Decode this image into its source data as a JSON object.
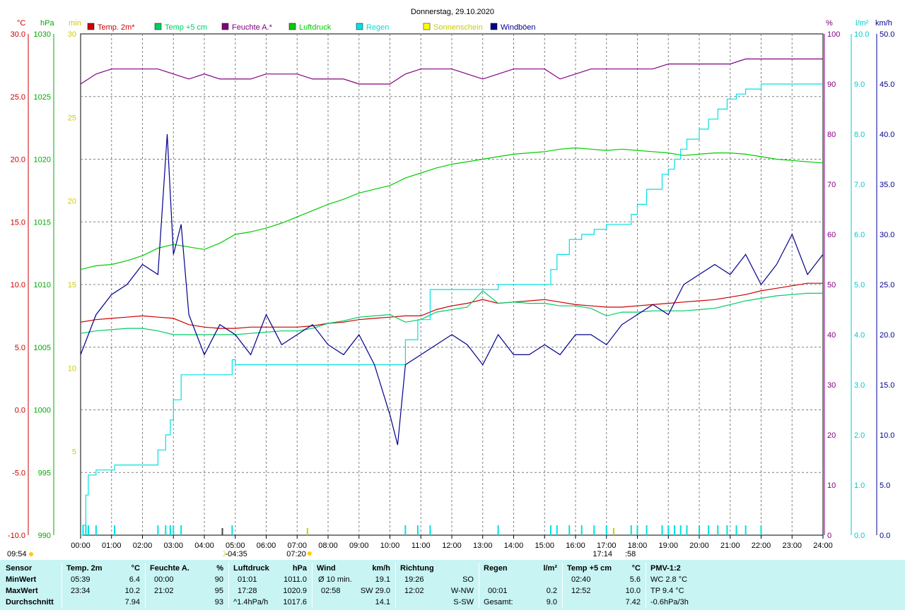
{
  "chart_data": {
    "type": "line",
    "title": "Donnerstag, 29.10.2020",
    "x_ticks": [
      "00:00",
      "01:00",
      "02:00",
      "03:00",
      "04:00",
      "05:00",
      "06:00",
      "07:00",
      "08:00",
      "09:00",
      "10:00",
      "11:00",
      "12:00",
      "13:00",
      "14:00",
      "15:00",
      "16:00",
      "17:00",
      "18:00",
      "19:00",
      "20:00",
      "21:00",
      "22:00",
      "23:00",
      "24:00"
    ],
    "xlim_hours": [
      0,
      24
    ],
    "axes": {
      "temp_c": {
        "unit": "°C",
        "range": [
          -10,
          30
        ],
        "ticks": [
          "-10.0",
          "-5.0",
          "0.0",
          "5.0",
          "10.0",
          "15.0",
          "20.0",
          "25.0",
          "30.0"
        ]
      },
      "pressure_hpa": {
        "unit": "hPa",
        "range": [
          990,
          1030
        ],
        "ticks": [
          "990",
          "995",
          "1000",
          "1005",
          "1010",
          "1015",
          "1020",
          "1025",
          "1030"
        ]
      },
      "sunshine_min": {
        "unit": "min",
        "range": [
          0,
          30
        ],
        "ticks": [
          "5",
          "10",
          "15",
          "20",
          "25",
          "30"
        ]
      },
      "humidity_pct": {
        "unit": "%",
        "range": [
          0,
          100
        ],
        "ticks": [
          "0",
          "10",
          "20",
          "30",
          "40",
          "50",
          "60",
          "70",
          "80",
          "90",
          "100"
        ]
      },
      "rain_lm2": {
        "unit": "l/m²",
        "range": [
          0,
          10
        ],
        "ticks": [
          "0.0",
          "1.0",
          "2.0",
          "3.0",
          "4.0",
          "5.0",
          "6.0",
          "7.0",
          "8.0",
          "9.0",
          "10.0"
        ]
      },
      "wind_kmh": {
        "unit": "km/h",
        "range": [
          0,
          50
        ],
        "ticks": [
          "0.0",
          "5.0",
          "10.0",
          "15.0",
          "20.0",
          "25.0",
          "30.0",
          "35.0",
          "40.0",
          "45.0",
          "50.0"
        ]
      }
    },
    "legend": [
      {
        "name": "Temp. 2m*",
        "color": "#cc0000"
      },
      {
        "name": "Temp +5 cm",
        "color": "#00cc66"
      },
      {
        "name": "Feuchte A.*",
        "color": "#800080"
      },
      {
        "name": "Luftdruck",
        "color": "#00cc00"
      },
      {
        "name": "Regen",
        "color": "#00e0e0"
      },
      {
        "name": "Sonnenschein",
        "color": "#ffff00"
      },
      {
        "name": "Windböen",
        "color": "#00008b"
      }
    ],
    "series": [
      {
        "name": "Temp. 2m*",
        "axis": "temp_c",
        "color": "#cc0000",
        "x": [
          0,
          0.5,
          1,
          1.5,
          2,
          2.5,
          3,
          3.5,
          4,
          4.5,
          5,
          5.5,
          6,
          6.5,
          7,
          7.5,
          8,
          8.5,
          9,
          9.5,
          10,
          10.5,
          11,
          11.5,
          12,
          12.5,
          13,
          13.5,
          14,
          14.5,
          15,
          15.5,
          16,
          16.5,
          17,
          17.5,
          18,
          18.5,
          19,
          19.5,
          20,
          20.5,
          21,
          21.5,
          22,
          22.5,
          23,
          23.5,
          24
        ],
        "values": [
          7.0,
          7.2,
          7.3,
          7.4,
          7.5,
          7.4,
          7.3,
          6.8,
          6.6,
          6.5,
          6.5,
          6.6,
          6.6,
          6.6,
          6.6,
          6.7,
          6.9,
          7.0,
          7.2,
          7.3,
          7.4,
          7.5,
          7.5,
          8.0,
          8.3,
          8.5,
          8.8,
          8.5,
          8.6,
          8.7,
          8.8,
          8.6,
          8.4,
          8.3,
          8.2,
          8.2,
          8.3,
          8.4,
          8.5,
          8.6,
          8.7,
          8.8,
          9.0,
          9.2,
          9.5,
          9.7,
          9.9,
          10.1,
          10.1
        ]
      },
      {
        "name": "Temp +5 cm",
        "axis": "temp_c",
        "color": "#00cc66",
        "x": [
          0,
          0.5,
          1,
          1.5,
          2,
          2.5,
          3,
          3.5,
          4,
          4.5,
          5,
          5.5,
          6,
          6.5,
          7,
          7.5,
          8,
          8.5,
          9,
          9.5,
          10,
          10.5,
          11,
          11.5,
          12,
          12.5,
          13,
          13.5,
          14,
          14.5,
          15,
          15.5,
          16,
          16.5,
          17,
          17.5,
          18,
          18.5,
          19,
          19.5,
          20,
          20.5,
          21,
          21.5,
          22,
          22.5,
          23,
          23.5,
          24
        ],
        "values": [
          6.1,
          6.3,
          6.4,
          6.5,
          6.5,
          6.3,
          6.0,
          6.0,
          6.0,
          6.0,
          6.0,
          6.1,
          6.2,
          6.3,
          6.3,
          6.5,
          6.9,
          7.1,
          7.4,
          7.5,
          7.6,
          7.0,
          7.2,
          7.8,
          8.0,
          8.2,
          9.5,
          8.5,
          8.6,
          8.5,
          8.5,
          8.3,
          8.3,
          8.1,
          7.5,
          7.8,
          7.8,
          7.9,
          7.9,
          7.9,
          8.0,
          8.1,
          8.4,
          8.7,
          8.9,
          9.1,
          9.2,
          9.3,
          9.3
        ]
      },
      {
        "name": "Feuchte A.*",
        "axis": "humidity_pct",
        "color": "#800080",
        "x": [
          0,
          0.5,
          1,
          1.5,
          2,
          2.5,
          3,
          3.5,
          4,
          4.5,
          5,
          5.5,
          6,
          6.5,
          7,
          7.5,
          8,
          8.5,
          9,
          9.5,
          10,
          10.5,
          11,
          11.5,
          12,
          12.5,
          13,
          13.5,
          14,
          14.5,
          15,
          15.5,
          16,
          16.5,
          17,
          17.5,
          18,
          18.5,
          19,
          19.5,
          20,
          20.5,
          21,
          21.5,
          22,
          22.5,
          23,
          23.5,
          24
        ],
        "values": [
          90,
          92,
          93,
          93,
          93,
          93,
          92,
          91,
          92,
          91,
          91,
          91,
          92,
          92,
          92,
          91,
          91,
          91,
          90,
          90,
          90,
          92,
          93,
          93,
          93,
          92,
          91,
          92,
          93,
          93,
          93,
          91,
          92,
          93,
          93,
          93,
          93,
          93,
          94,
          94,
          94,
          94,
          94,
          95,
          95,
          95,
          95,
          95,
          95
        ]
      },
      {
        "name": "Luftdruck",
        "axis": "pressure_hpa",
        "color": "#00cc00",
        "x": [
          0,
          0.5,
          1,
          1.5,
          2,
          2.5,
          3,
          3.5,
          4,
          4.5,
          5,
          5.5,
          6,
          6.5,
          7,
          7.5,
          8,
          8.5,
          9,
          9.5,
          10,
          10.5,
          11,
          11.5,
          12,
          12.5,
          13,
          13.5,
          14,
          14.5,
          15,
          15.5,
          16,
          16.5,
          17,
          17.5,
          18,
          18.5,
          19,
          19.5,
          20,
          20.5,
          21,
          21.5,
          22,
          22.5,
          23,
          23.5,
          24
        ],
        "values": [
          1011.2,
          1011.5,
          1011.6,
          1011.9,
          1012.3,
          1012.9,
          1013.2,
          1013.0,
          1012.8,
          1013.3,
          1014.0,
          1014.2,
          1014.5,
          1014.9,
          1015.4,
          1015.9,
          1016.4,
          1016.8,
          1017.3,
          1017.6,
          1017.9,
          1018.5,
          1018.9,
          1019.3,
          1019.6,
          1019.8,
          1020.0,
          1020.2,
          1020.4,
          1020.5,
          1020.6,
          1020.8,
          1020.9,
          1020.8,
          1020.7,
          1020.8,
          1020.7,
          1020.6,
          1020.5,
          1020.3,
          1020.4,
          1020.5,
          1020.5,
          1020.4,
          1020.2,
          1020.0,
          1019.9,
          1019.8,
          1019.7
        ]
      },
      {
        "name": "Regen",
        "axis": "rain_lm2",
        "color": "#00e0e0",
        "step": true,
        "x": [
          0,
          0.08,
          0.17,
          0.25,
          0.5,
          1.1,
          2.2,
          2.5,
          2.75,
          2.9,
          3.0,
          3.25,
          4.65,
          4.9,
          5.0,
          10.3,
          10.5,
          10.9,
          11.3,
          13.4,
          13.5,
          15.2,
          15.4,
          15.8,
          16.2,
          16.6,
          17.0,
          17.8,
          18.0,
          18.3,
          18.8,
          19.0,
          19.2,
          19.4,
          19.6,
          20.0,
          20.3,
          20.6,
          20.9,
          21.2,
          21.5,
          22.0,
          24.0
        ],
        "values": [
          0,
          0.2,
          0.8,
          1.2,
          1.3,
          1.4,
          1.4,
          1.7,
          2.0,
          2.3,
          2.7,
          3.2,
          3.2,
          3.5,
          3.4,
          3.4,
          3.9,
          4.3,
          4.9,
          4.9,
          5.0,
          5.3,
          5.6,
          5.9,
          6.0,
          6.1,
          6.2,
          6.4,
          6.6,
          6.9,
          7.2,
          7.3,
          7.5,
          7.7,
          7.9,
          8.1,
          8.3,
          8.5,
          8.7,
          8.8,
          8.9,
          9.0,
          9.0
        ]
      },
      {
        "name": "Windböen",
        "axis": "wind_kmh",
        "color": "#00008b",
        "x": [
          0,
          0.5,
          1,
          1.5,
          2,
          2.5,
          2.8,
          3,
          3.25,
          3.5,
          4,
          4.5,
          5,
          5.5,
          6,
          6.5,
          7,
          7.5,
          8,
          8.5,
          9,
          9.5,
          10,
          10.25,
          10.5,
          11,
          11.5,
          12,
          12.5,
          13,
          13.5,
          14,
          14.5,
          15,
          15.5,
          16,
          16.5,
          17,
          17.5,
          18,
          18.5,
          19,
          19.5,
          20,
          20.5,
          21,
          21.5,
          22,
          22.5,
          23,
          23.5,
          24
        ],
        "values": [
          18,
          22,
          24,
          25,
          27,
          26,
          40,
          28,
          31,
          22,
          18,
          21,
          20,
          18,
          22,
          19,
          20,
          21,
          19,
          18,
          20,
          17,
          12,
          9,
          17,
          18,
          19,
          20,
          19,
          17,
          20,
          18,
          18,
          19,
          18,
          20,
          20,
          19,
          21,
          22,
          23,
          22,
          25,
          26,
          27,
          26,
          28,
          25,
          27,
          30,
          26,
          28
        ]
      }
    ],
    "sun": {
      "sunrise": "07:20",
      "sunset": "17:14",
      "moonrise": "04:35",
      "moon_tail": ":58",
      "time_label": "09:54"
    }
  },
  "stats": {
    "headers": {
      "sensor": "Sensor",
      "temp": "Temp. 2m",
      "temp_unit": "°C",
      "hum": "Feuchte A.",
      "hum_unit": "%",
      "press": "Luftdruck",
      "press_unit": "hPa",
      "wind": "Wind",
      "wind_unit": "km/h",
      "dir": "Richtung",
      "rain": "Regen",
      "rain_unit": "l/m²",
      "t5": "Temp +5 cm",
      "t5_unit": "°C",
      "pmv": "PMV-1:2"
    },
    "rows": [
      "MinWert",
      "MaxWert",
      "Durchschnitt"
    ],
    "temp": [
      [
        "05:39",
        "6.4"
      ],
      [
        "23:34",
        "10.2"
      ],
      [
        "",
        "7.94"
      ]
    ],
    "hum": [
      [
        "00:00",
        "90"
      ],
      [
        "21:02",
        "95"
      ],
      [
        "",
        "93"
      ]
    ],
    "press": [
      [
        "01:01",
        "1011.0"
      ],
      [
        "17:28",
        "1020.9"
      ],
      [
        "^1.4hPa/h",
        "1017.6"
      ]
    ],
    "wind": [
      [
        "Ø 10 min.",
        "19.1"
      ],
      [
        "02:58",
        "SW 29.0"
      ],
      [
        "",
        "14.1"
      ]
    ],
    "dir": [
      [
        "19:26",
        "SO"
      ],
      [
        "12:02",
        "W-NW"
      ],
      [
        "",
        "S-SW"
      ]
    ],
    "rain": [
      [
        "",
        ""
      ],
      [
        "00:01",
        "0.2"
      ],
      [
        "Gesamt:",
        "9.0"
      ]
    ],
    "t5": [
      [
        "02:40",
        "5.6"
      ],
      [
        "12:52",
        "10.0"
      ],
      [
        "",
        "7.42"
      ]
    ],
    "pmv": [
      "WC 2.8 °C",
      "TP 9.4 °C",
      "-0.6hPa/3h"
    ]
  }
}
